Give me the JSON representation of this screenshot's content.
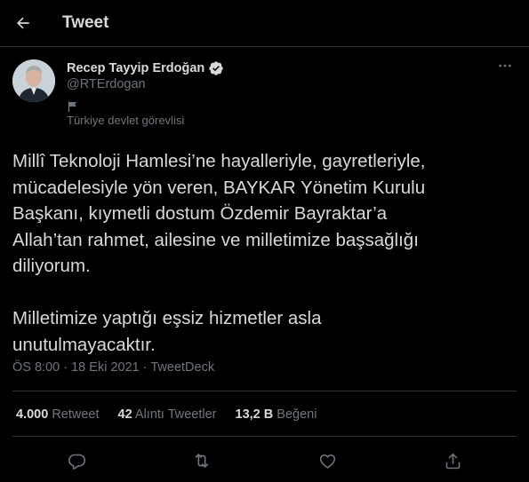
{
  "header": {
    "title": "Tweet",
    "back_icon": "arrow-left-icon"
  },
  "author": {
    "name": "Recep Tayyip Erdoğan",
    "handle": "@RTErdogan",
    "verified_icon": "verified-badge-icon",
    "government_label": "Türkiye devlet görevlisi",
    "government_icon": "flag-icon"
  },
  "tweet": {
    "paragraph_1_lines": [
      "Millî Teknoloji Hamlesi’ne hayalleriyle, gayretleriyle,",
      "mücadelesiyle yön veren, BAYKAR Yönetim Kurulu",
      "Başkanı, kıymetli dostum Özdemir Bayraktar’a",
      "Allah’tan rahmet, ailesine ve milletimize başsağlığı",
      "diliyorum."
    ],
    "paragraph_2_lines": [
      "Milletimize yaptığı eşsiz hizmetler asla",
      "unutulmayacaktır."
    ],
    "time": "ÖS 8:00",
    "date": "18 Eki 2021",
    "separator": "·",
    "source": "TweetDeck"
  },
  "stats": {
    "retweets_count": "4.000",
    "retweets_label": "Retweet",
    "quotes_count": "42",
    "quotes_label": "Alıntı Tweetler",
    "likes_count": "13,2 B",
    "likes_label": "Beğeni"
  },
  "actions": {
    "reply_icon": "reply-icon",
    "retweet_icon": "retweet-icon",
    "like_icon": "heart-icon",
    "share_icon": "share-icon"
  },
  "colors": {
    "background": "#000000",
    "text_primary": "#d9d9d9",
    "text_secondary": "#6e767d",
    "divider": "#2f3336",
    "verified_badge": "#d9d9d9"
  }
}
